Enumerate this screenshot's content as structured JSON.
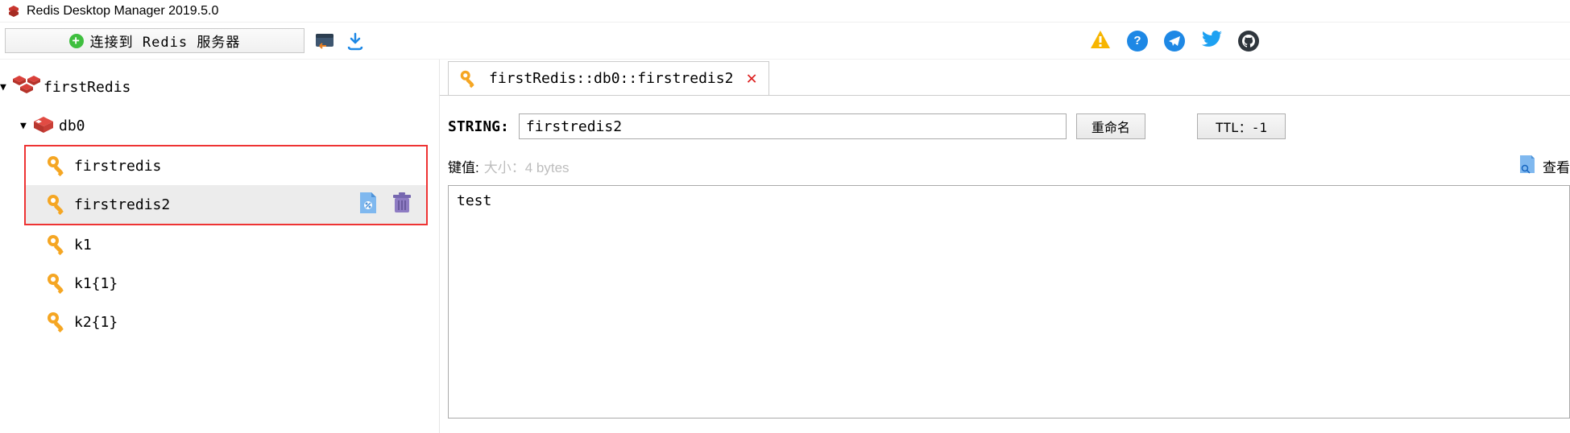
{
  "titlebar": {
    "title": "Redis Desktop Manager 2019.5.0"
  },
  "toolbar": {
    "connect_label": "连接到 Redis 服务器",
    "connect_icon": "plus-circle-icon",
    "import_icon": "terminal-import-icon",
    "download_icon": "download-icon",
    "right_icons": [
      "warn-icon",
      "help-icon",
      "telegram-icon",
      "twitter-icon",
      "github-icon"
    ]
  },
  "tree": {
    "connection": {
      "name": "firstRedis"
    },
    "db": {
      "name": "db0"
    },
    "keys": [
      {
        "name": "firstredis",
        "selected": false,
        "highlighted": true
      },
      {
        "name": "firstredis2",
        "selected": true,
        "highlighted": true
      },
      {
        "name": "k1",
        "selected": false,
        "highlighted": false
      },
      {
        "name": "k1{1}",
        "selected": false,
        "highlighted": false
      },
      {
        "name": "k2{1}",
        "selected": false,
        "highlighted": false
      }
    ]
  },
  "tab": {
    "title": "firstRedis::db0::firstredis2"
  },
  "detail": {
    "type_label": "STRING:",
    "key_name": "firstredis2",
    "rename_label": "重命名",
    "ttl_label": "TTL：-1",
    "value_header_label": "键值:",
    "value_size_label": "大小：4 bytes",
    "view_label": "查看",
    "value": "test"
  }
}
